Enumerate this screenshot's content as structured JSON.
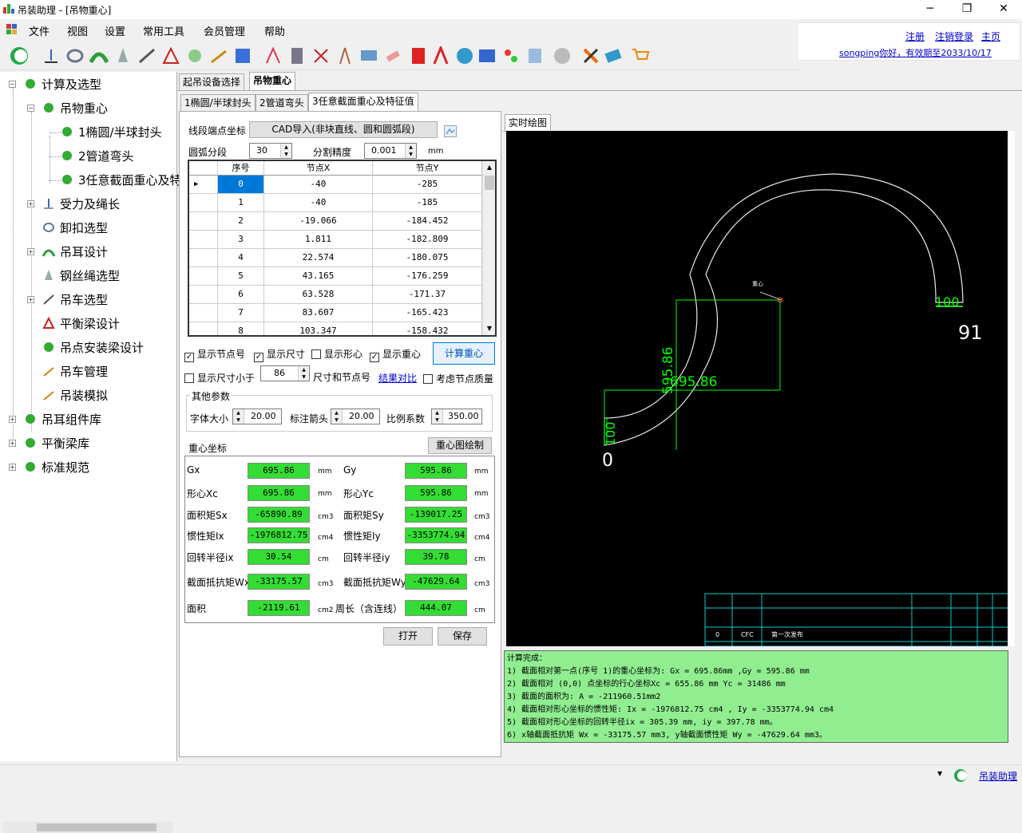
{
  "window": {
    "title": "吊装助理 - [吊物重心]",
    "minimize": "─",
    "restore": "❐",
    "close": "✕"
  },
  "menu": [
    "文件",
    "视图",
    "设置",
    "常用工具",
    "会员管理",
    "帮助"
  ],
  "user": {
    "register": "注册",
    "logout": "注销登录",
    "home": "主页",
    "status": "songping你好，有效期至2033/10/17"
  },
  "tree": {
    "items": [
      "计算及选型",
      "吊物重心",
      "1椭圆/半球封头",
      "2管道弯头",
      "3任意截面重心及特",
      "受力及绳长",
      "卸扣选型",
      "吊耳设计",
      "钢丝绳选型",
      "吊车选型",
      "平衡梁设计",
      "吊点安装梁设计",
      "吊车管理",
      "吊装模拟",
      "吊耳组件库",
      "平衡梁库",
      "标准规范"
    ]
  },
  "tabs": {
    "top": [
      "起吊设备选择",
      "吊物重心"
    ],
    "sub": [
      "1椭圆/半球封头",
      "2管道弯头",
      "3任意截面重心及特征值"
    ]
  },
  "form": {
    "coords_label": "线段端点坐标",
    "cad_import": "CAD导入(非块直线、圆和圆弧段)",
    "arc_label": "圆弧分段",
    "arc_value": "30",
    "precision_label": "分割精度",
    "precision_value": "0.001",
    "precision_unit": "mm"
  },
  "grid": {
    "headers": [
      "序号",
      "节点X",
      "节点Y"
    ],
    "rows": [
      [
        "0",
        "-40",
        "-285"
      ],
      [
        "1",
        "-40",
        "-185"
      ],
      [
        "2",
        "-19.066",
        "-184.452"
      ],
      [
        "3",
        "1.811",
        "-182.809"
      ],
      [
        "4",
        "22.574",
        "-180.075"
      ],
      [
        "5",
        "43.165",
        "-176.259"
      ],
      [
        "6",
        "63.528",
        "-171.37"
      ],
      [
        "7",
        "83.607",
        "-165.423"
      ],
      [
        "8",
        "103.347",
        "-158.432"
      ]
    ]
  },
  "options": {
    "show_node": "显示节点号",
    "show_dim": "显示尺寸",
    "show_centroid": "显示形心",
    "show_cog": "显示重心",
    "calc": "计算重心",
    "show_dim_less": "显示尺寸小于",
    "dim_value": "86",
    "dim_suffix": "尺寸和节点号",
    "compare": "结果对比",
    "node_mass": "考虑节点质量"
  },
  "other": {
    "legend": "其他参数",
    "font_label": "字体大小",
    "font_value": "20.00",
    "arrow_label": "标注箭头",
    "arrow_value": "20.00",
    "scale_label": "比例系数",
    "scale_value": "350.00"
  },
  "results": {
    "title": "重心坐标",
    "draw_btn": "重心图绘制",
    "rows": [
      {
        "l1": "Gx",
        "v1": "695.86",
        "u1": "mm",
        "l2": "Gy",
        "v2": "595.86",
        "u2": "mm"
      },
      {
        "l1": "形心Xc",
        "v1": "695.86",
        "u1": "mm",
        "l2": "形心Yc",
        "v2": "595.86",
        "u2": "mm"
      },
      {
        "l1": "面积矩Sx",
        "v1": "-65890.89",
        "u1": "cm3",
        "l2": "面积矩Sy",
        "v2": "-139017.25",
        "u2": "cm3"
      },
      {
        "l1": "惯性矩Ix",
        "v1": "-1976812.75",
        "u1": "cm4",
        "l2": "惯性矩Iy",
        "v2": "-3353774.94",
        "u2": "cm4"
      },
      {
        "l1": "回转半径ix",
        "v1": "30.54",
        "u1": "cm",
        "l2": "回转半径iy",
        "v2": "39.78",
        "u2": "cm"
      },
      {
        "l1": "截面抵抗矩Wx",
        "v1": "-33175.57",
        "u1": "cm3",
        "l2": "截面抵抗矩Wy",
        "v2": "-47629.64",
        "u2": "cm3"
      },
      {
        "l1": "面积",
        "v1": "-2119.61",
        "u1": "cm2",
        "l2": "周长（含连线）",
        "v2": "444.07",
        "u2": "cm"
      }
    ],
    "open": "打开",
    "save": "保存"
  },
  "drawing": {
    "tab": "实时绘图",
    "dim_main": "695.86",
    "dim_vert": "595.86",
    "dim_small": "100",
    "dim_small2": "100",
    "node_start": "0",
    "node_end": "91",
    "cog_label": "重心",
    "tb_rev": "0",
    "tb_code": "CFC",
    "tb_desc": "第一次发布"
  },
  "output": [
    "计算完成：",
    "1) 截面相对第一点(序号 1)的重心坐标为: Gx = 695.86mm ,Gy = 595.86 mm",
    "2) 截面相对 (0,0) 点坐标的行心坐标Xc = 655.86 mm Yc = 31486 mm",
    "3) 截面的面积为: A = -211960.51mm2",
    "4) 截面相对形心坐标的惯性矩: Ix = -1976812.75 cm4 , Iy = -3353774.94 cm4",
    "5) 截面相对形心坐标的回转半径ix = 305.39 mm, iy = 397.78 mm。",
    "6) x轴截面抵抗矩 Wx = -33175.57 mm3, y轴截面惯性矩 Wy = -47629.64 mm3。"
  ],
  "statusbar": {
    "app": "吊装助理"
  }
}
